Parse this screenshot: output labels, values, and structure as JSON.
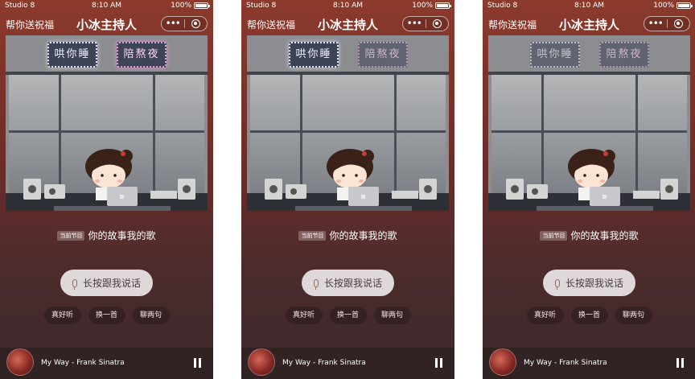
{
  "status": {
    "carrier": "Studio 8",
    "time": "8:10 AM",
    "battery": "100%"
  },
  "nav": {
    "left_link": "帮你送祝福",
    "title": "小冰主持人",
    "more_label": "•••"
  },
  "signs": {
    "left": "哄你睡",
    "right": "陪熬夜"
  },
  "screens": [
    {
      "lit_sign": "both"
    },
    {
      "lit_sign": "left"
    },
    {
      "lit_sign": "none"
    }
  ],
  "now_playing": {
    "tag": "当前节目",
    "program": "你的故事我的歌"
  },
  "talk_button": {
    "label": "长按跟我说话"
  },
  "chips": [
    "真好听",
    "换一首",
    "聊两句"
  ],
  "player": {
    "song": "My Way - Frank Sinatra"
  },
  "colors": {
    "background_top": "#8c3a2c",
    "background_bottom": "#3a2a2c",
    "button_bg": "#f0e8e6"
  }
}
